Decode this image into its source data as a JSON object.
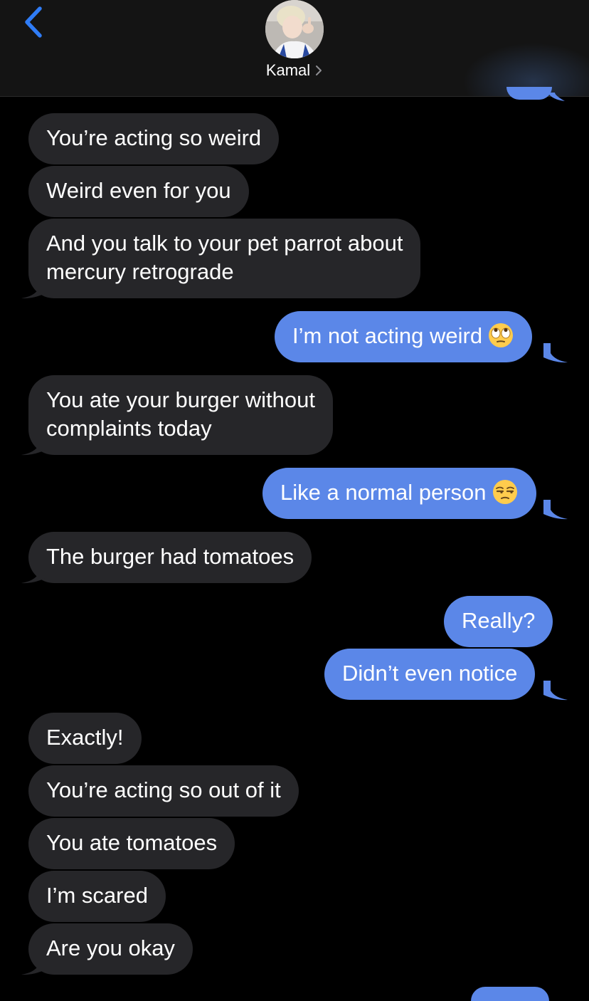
{
  "header": {
    "contact_name": "Kamal"
  },
  "colors": {
    "incoming_bubble": "#262629",
    "outgoing_bubble": "#5b87e8",
    "back_accent": "#2f7cf6",
    "background": "#000000"
  },
  "icons": {
    "back": "chevron-left-icon",
    "contact_disclosure": "chevron-right-icon",
    "emoji_1": "eye-roll-emoji",
    "emoji_2": "unamused-face-emoji"
  },
  "messages": [
    {
      "from": "contact",
      "text": "You’re acting so weird"
    },
    {
      "from": "contact",
      "text": "Weird even for you"
    },
    {
      "from": "contact",
      "lines": [
        "And you talk to your pet parrot about",
        "mercury retrograde"
      ]
    },
    {
      "from": "me",
      "text": "I’m not acting weird",
      "emoji": "🙄"
    },
    {
      "from": "contact",
      "lines": [
        "You ate your burger without",
        "complaints today"
      ]
    },
    {
      "from": "me",
      "text": "Like a normal person",
      "emoji": "😒"
    },
    {
      "from": "contact",
      "text": "The burger had tomatoes"
    },
    {
      "from": "me",
      "text": "Really?"
    },
    {
      "from": "me",
      "text": "Didn’t even notice"
    },
    {
      "from": "contact",
      "text": "Exactly!"
    },
    {
      "from": "contact",
      "text": "You’re acting so out of it"
    },
    {
      "from": "contact",
      "text": "You ate tomatoes"
    },
    {
      "from": "contact",
      "text": "I’m scared"
    },
    {
      "from": "contact",
      "text": "Are you okay"
    }
  ]
}
